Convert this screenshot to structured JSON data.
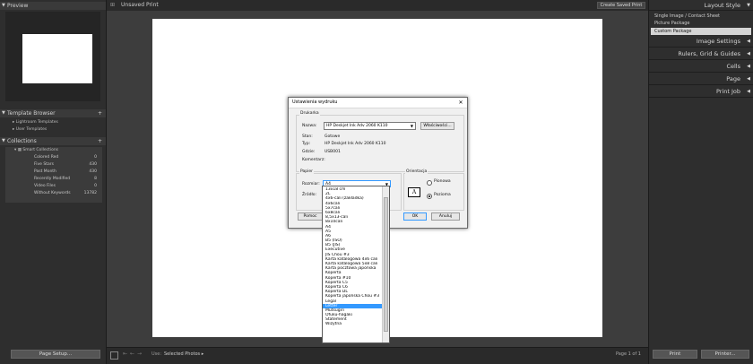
{
  "left": {
    "preview_label": "Preview",
    "template_browser": {
      "label": "Template Browser",
      "items": [
        "Lightroom Templates",
        "User Templates"
      ]
    },
    "collections": {
      "label": "Collections",
      "smart_label": "Smart Collections",
      "items": [
        {
          "name": "Colored Red",
          "count": "0"
        },
        {
          "name": "Five Stars",
          "count": "430"
        },
        {
          "name": "Past Month",
          "count": "430"
        },
        {
          "name": "Recently Modified",
          "count": "8"
        },
        {
          "name": "Video Files",
          "count": "0"
        },
        {
          "name": "Without Keywords",
          "count": "13782"
        }
      ]
    },
    "page_setup_label": "Page Setup..."
  },
  "top": {
    "doc_title": "Unsaved Print",
    "create_saved_label": "Create Saved Print"
  },
  "right": {
    "layout_style": "Layout Style",
    "layout_items": [
      "Single Image / Contact Sheet",
      "Picture Package",
      "Custom Package"
    ],
    "sections": [
      "Image Settings",
      "Rulers, Grid & Guides",
      "Cells",
      "Page",
      "Print Job"
    ],
    "print_label": "Print",
    "printer_label": "Printer..."
  },
  "bottom": {
    "use_label": "Use:",
    "use_value": "Selected Photos",
    "page_info": "Page 1 of 1"
  },
  "dialog": {
    "title": "Ustawienia wydruku",
    "printer_group": "Drukarka",
    "name_label": "Nazwa:",
    "name_value": "HP Deskjet Ink Adv 2060 K110",
    "properties_label": "Właściwości...",
    "status_label": "Stan:",
    "status_value": "Gotowe",
    "type_label": "Typ:",
    "type_value": "HP Deskjet Ink Adv 2060 K110",
    "where_label": "Gdzie:",
    "where_value": "USB001",
    "comment_label": "Komentarz:",
    "paper_group": "Papier",
    "size_label": "Rozmiar:",
    "size_value": "A4",
    "source_label": "Źródło:",
    "orientation_group": "Orientacja",
    "portrait_label": "Pionowa",
    "landscape_label": "Pozioma",
    "help_label": "Pomoc",
    "ok_label": "OK",
    "cancel_label": "Anuluj",
    "dropdown_items": [
      "13x18 cm",
      "2L",
      "4x6-cali (zakładka)",
      "4x6cali",
      "5x7cali",
      "6x8cali",
      "8,5x13-cali",
      "8x10cali",
      "A4",
      "A5",
      "A6",
      "B5 (ISO)",
      "B5 (JIS)",
      "Executive",
      "JIS Chou #3",
      "Karta katalogowa 4x6 cali",
      "Karta katalogowa 5x8 cali",
      "Karta pocztowa japońska",
      "Koperta",
      "Koperta #10",
      "Koperta C5",
      "Koperta C6",
      "Koperta DL",
      "Koperta japońska Chou #3",
      "Legal",
      "Letter",
      "Mutsugiri",
      "Ofuku-hagaki",
      "Statement",
      "Wizytna"
    ],
    "selected_index": 25
  },
  "colors": {
    "selection": "#3399ff",
    "panel": "#2b2b2b",
    "canvas": "#3d3d3d"
  }
}
